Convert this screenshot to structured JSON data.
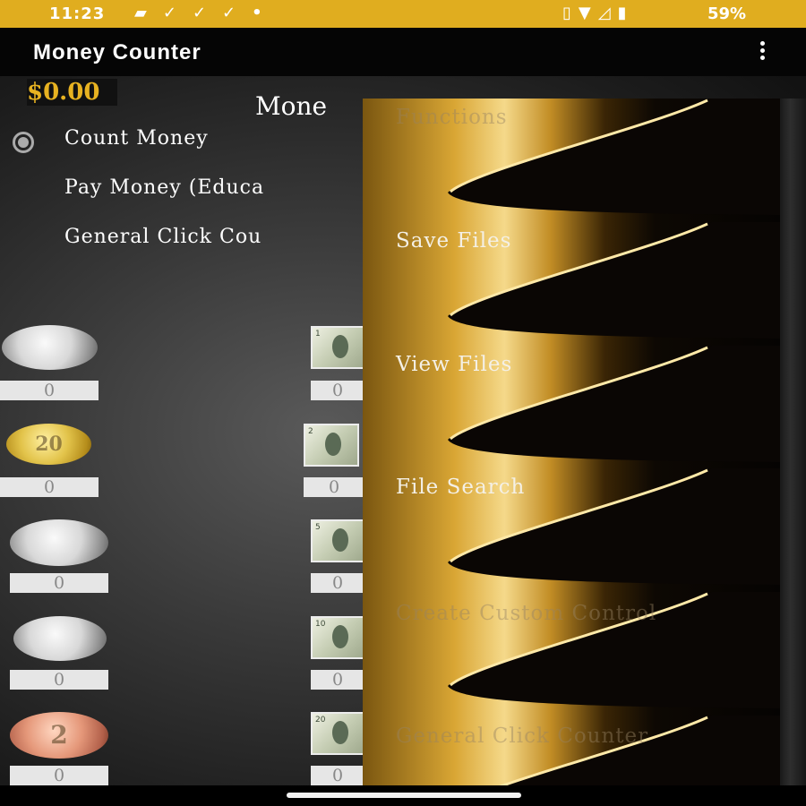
{
  "status_bar": {
    "time": "11:23",
    "notification_icons": [
      "chat-bubble-icon",
      "task-check-icon",
      "task-check-icon",
      "task-check-icon",
      "dot-icon"
    ],
    "system_icons": [
      "vibrate-icon",
      "wifi-icon",
      "signal-icon",
      "battery-icon"
    ],
    "battery": "59%",
    "color": "#e0ad1f"
  },
  "app_bar": {
    "title": "Money Counter",
    "menu_icon": "overflow-menu-icon"
  },
  "main": {
    "total": "$0.00",
    "mode_heading": "Mone",
    "modes": [
      {
        "label": "Count Money",
        "selected": true
      },
      {
        "label": "Pay Money (Educa",
        "selected": false
      },
      {
        "label": "General Click Cou",
        "selected": false
      }
    ],
    "coins": [
      {
        "name": "quarter",
        "count": "0"
      },
      {
        "name": "euro-20-cent",
        "count": "0"
      },
      {
        "name": "dime",
        "count": "0"
      },
      {
        "name": "nickel",
        "count": "0"
      },
      {
        "name": "euro-2-cent",
        "count": "0"
      }
    ],
    "bills": [
      {
        "name": "one-dollar",
        "count": "0"
      },
      {
        "name": "two-dollar",
        "count": "0"
      },
      {
        "name": "five-dollar",
        "count": "0"
      },
      {
        "name": "ten-dollar",
        "count": "0"
      },
      {
        "name": "twenty-dollar",
        "count": "0"
      }
    ],
    "bill_count_visible": "0",
    "coin_glyph_20": "20",
    "coin_glyph_2": "2"
  },
  "drawer": {
    "heading": "Functions",
    "items": [
      {
        "label": "Save Files",
        "enabled": true
      },
      {
        "label": "View Files",
        "enabled": true
      },
      {
        "label": "File Search",
        "enabled": true
      },
      {
        "label": "Create Custom Control",
        "enabled": false
      },
      {
        "label": "General Click Counter",
        "enabled": false
      }
    ]
  },
  "colors": {
    "accent_gold": "#e7b221",
    "status_bar": "#e0ad1f",
    "app_bar": "#050505"
  }
}
